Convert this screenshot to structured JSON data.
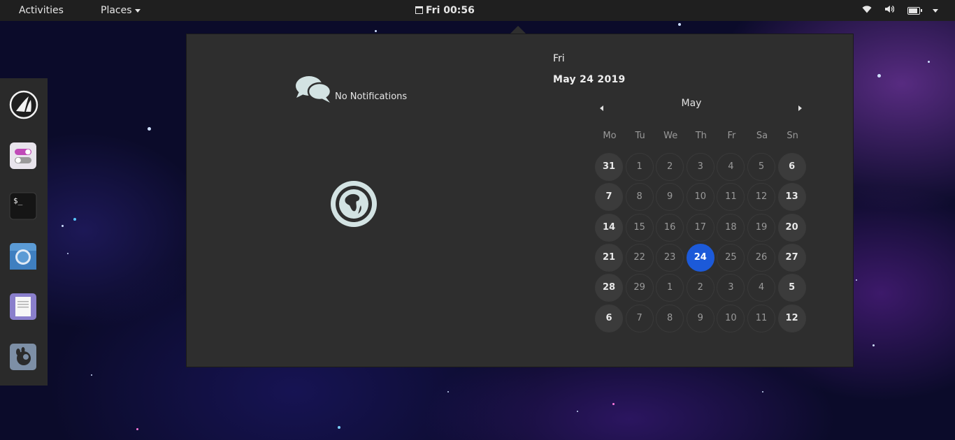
{
  "topbar": {
    "activities": "Activities",
    "places": "Places",
    "clock": "Fri 00:56"
  },
  "tray": {
    "icons": [
      "wifi-icon",
      "volume-icon",
      "battery-icon",
      "system-menu-caret-icon"
    ]
  },
  "dock": {
    "apps": [
      {
        "name": "dock-app-launcher",
        "icon": "sail-logo-icon"
      },
      {
        "name": "dock-app-tweaks",
        "icon": "toggle-switches-icon"
      },
      {
        "name": "dock-app-terminal",
        "icon": "terminal-icon"
      },
      {
        "name": "dock-app-chromium",
        "icon": "chromium-icon"
      },
      {
        "name": "dock-app-text-editor",
        "icon": "document-icon"
      },
      {
        "name": "dock-app-gimp",
        "icon": "gimp-icon"
      }
    ]
  },
  "notifications": {
    "empty_text": "No Notifications",
    "icon": "chat-bubbles-icon",
    "world_clock_icon": "world-clocks-icon"
  },
  "date": {
    "day_name": "Fri",
    "full_date": "May 24 2019"
  },
  "calendar": {
    "month": "May",
    "weekdays": [
      "Mo",
      "Tu",
      "We",
      "Th",
      "Fr",
      "Sa",
      "Sn"
    ],
    "weeks": [
      [
        "31",
        "1",
        "2",
        "3",
        "4",
        "5",
        "6"
      ],
      [
        "7",
        "8",
        "9",
        "10",
        "11",
        "12",
        "13"
      ],
      [
        "14",
        "15",
        "16",
        "17",
        "18",
        "19",
        "20"
      ],
      [
        "21",
        "22",
        "23",
        "24",
        "25",
        "26",
        "27"
      ],
      [
        "28",
        "29",
        "1",
        "2",
        "3",
        "4",
        "5"
      ],
      [
        "6",
        "7",
        "8",
        "9",
        "10",
        "11",
        "12"
      ]
    ],
    "today": "24",
    "accent": "#1c5ad9"
  }
}
